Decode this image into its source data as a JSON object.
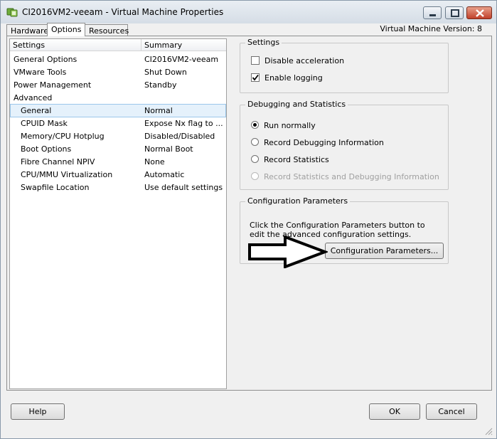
{
  "window": {
    "title": "CI2016VM2-veeam - Virtual Machine Properties",
    "vm_version": "Virtual Machine Version: 8"
  },
  "tabs": [
    {
      "label": "Hardware",
      "active": false
    },
    {
      "label": "Options",
      "active": true
    },
    {
      "label": "Resources",
      "active": false
    }
  ],
  "settings_list": {
    "col_settings": "Settings",
    "col_summary": "Summary",
    "rows": [
      {
        "name": "General Options",
        "summary": "CI2016VM2-veeam",
        "indent": 0
      },
      {
        "name": "VMware Tools",
        "summary": "Shut Down",
        "indent": 0
      },
      {
        "name": "Power Management",
        "summary": "Standby",
        "indent": 0
      },
      {
        "name": "Advanced",
        "summary": "",
        "indent": 0
      },
      {
        "name": "General",
        "summary": "Normal",
        "indent": 1,
        "selected": true
      },
      {
        "name": "CPUID Mask",
        "summary": "Expose Nx flag to ...",
        "indent": 1
      },
      {
        "name": "Memory/CPU Hotplug",
        "summary": "Disabled/Disabled",
        "indent": 1
      },
      {
        "name": "Boot Options",
        "summary": "Normal Boot",
        "indent": 1
      },
      {
        "name": "Fibre Channel NPIV",
        "summary": "None",
        "indent": 1
      },
      {
        "name": "CPU/MMU Virtualization",
        "summary": "Automatic",
        "indent": 1
      },
      {
        "name": "Swapfile Location",
        "summary": "Use default settings",
        "indent": 1
      }
    ]
  },
  "settings_group": {
    "title": "Settings",
    "disable_acceleration": {
      "label": "Disable acceleration",
      "checked": false
    },
    "enable_logging": {
      "label": "Enable logging",
      "checked": true
    }
  },
  "debug_group": {
    "title": "Debugging and Statistics",
    "options": [
      {
        "label": "Run normally",
        "selected": true,
        "disabled": false
      },
      {
        "label": "Record Debugging Information",
        "selected": false,
        "disabled": false
      },
      {
        "label": "Record Statistics",
        "selected": false,
        "disabled": false
      },
      {
        "label": "Record Statistics and Debugging Information",
        "selected": false,
        "disabled": true
      }
    ]
  },
  "config_group": {
    "title": "Configuration Parameters",
    "description": "Click the Configuration Parameters button to edit the advanced configuration settings.",
    "button_label": "Configuration Parameters..."
  },
  "footer": {
    "help": "Help",
    "ok": "OK",
    "cancel": "Cancel"
  },
  "icons": [
    "vm-properties-icon",
    "minimize-icon",
    "maximize-icon",
    "close-icon",
    "arrow-right-icon",
    "resize-grip-icon"
  ],
  "colors": {
    "selection": "#e5f1fb",
    "selection_border": "#9cc7ea",
    "close_button": "#c1402a"
  }
}
